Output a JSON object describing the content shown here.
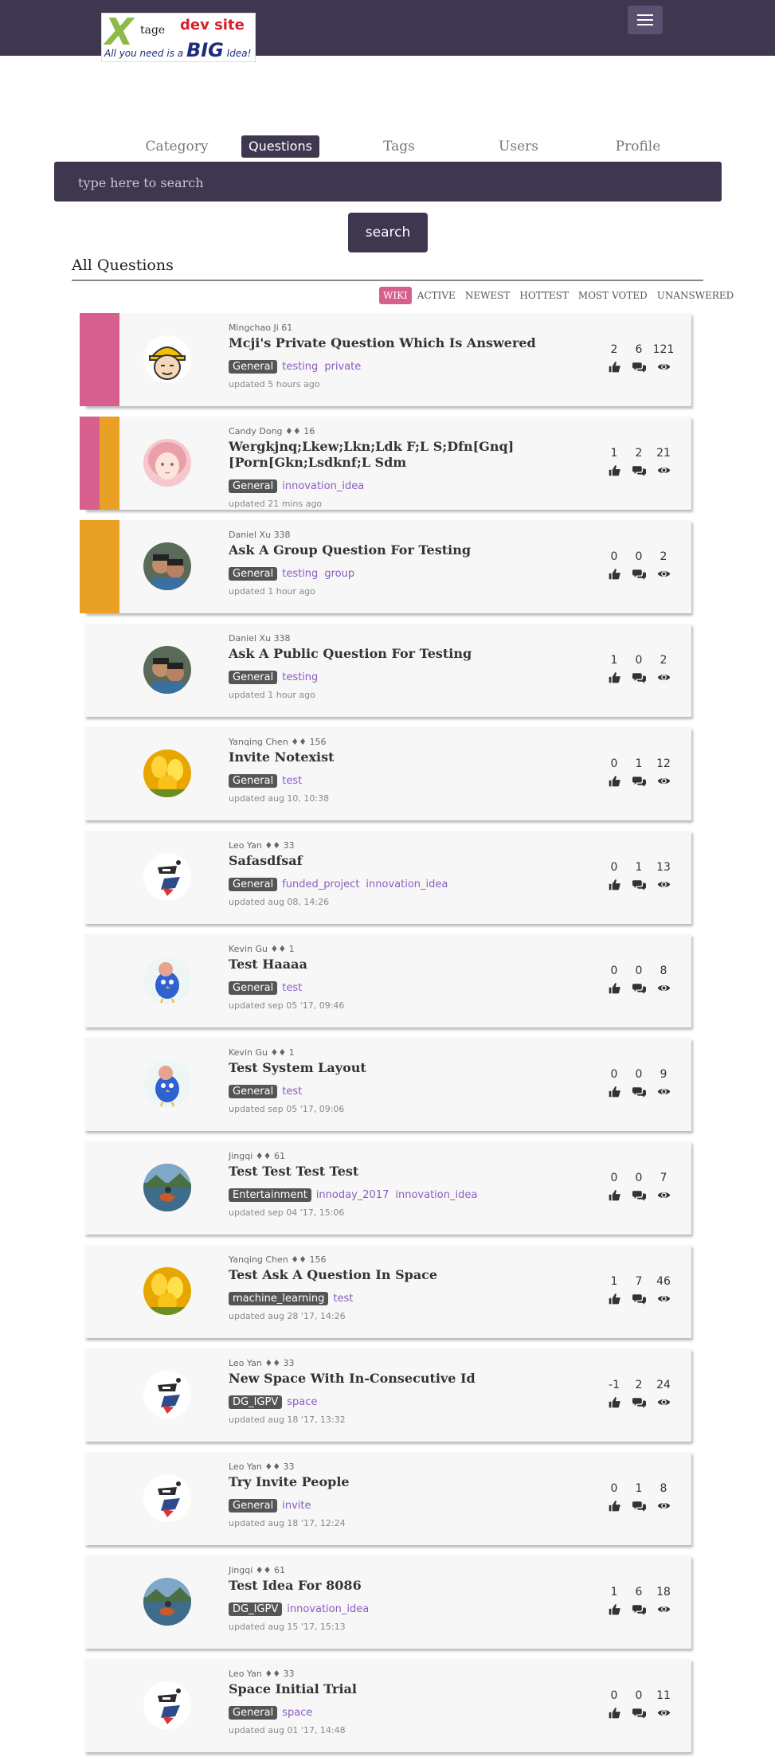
{
  "header": {
    "logo": {
      "letter": "X",
      "tage": "tage",
      "dev": "dev site",
      "slogan_pre": "All you need is a",
      "slogan_big": "BIG",
      "slogan_post": "Idea!"
    },
    "menu_icon": "hamburger-icon"
  },
  "nav": {
    "tabs": [
      "Category",
      "Questions",
      "Tags",
      "Users",
      "Profile"
    ],
    "active": "Questions"
  },
  "search": {
    "placeholder": "type here to search",
    "button": "search"
  },
  "section": {
    "title": "All Questions"
  },
  "filters": [
    "WIKI",
    "ACTIVE",
    "NEWEST",
    "HOTTEST",
    "MOST VOTED",
    "UNANSWERED"
  ],
  "colors": {
    "topbar": "#3f3650",
    "pink_flag": "#d65f8e",
    "orange_flag": "#e8a125",
    "tag": "#8c5cc0",
    "category": "#555555"
  },
  "questions": [
    {
      "author": "Mingchao Ji",
      "rep": "61",
      "title": "Mcji's Private Question Which Is Answered",
      "category": "General",
      "tags": [
        "testing",
        "private"
      ],
      "updated": "updated 5 hours ago",
      "votes": "2",
      "answers": "6",
      "views": "121",
      "avatar": "helmet-avatar",
      "flags": [
        "pink"
      ]
    },
    {
      "author": "Candy Dong",
      "rep": "♦♦ 16",
      "title": "Wergkjnq;Lkew;Lkn;Ldk F;L S;Dfn[Gnq][Porn[Gkn;Lsdknf;L Sdm",
      "category": "General",
      "tags": [
        "innovation_idea"
      ],
      "updated": "updated 21 mins ago",
      "votes": "1",
      "answers": "2",
      "views": "21",
      "avatar": "girl-avatar",
      "flags": [
        "pink",
        "orange"
      ]
    },
    {
      "author": "Daniel Xu",
      "rep": "338",
      "title": "Ask A Group Question For Testing",
      "category": "General",
      "tags": [
        "testing",
        "group"
      ],
      "updated": "updated 1 hour ago",
      "votes": "0",
      "answers": "0",
      "views": "2",
      "avatar": "kids-avatar",
      "flags": [
        "orange"
      ]
    },
    {
      "author": "Daniel Xu",
      "rep": "338",
      "title": "Ask A Public Question For Testing",
      "category": "General",
      "tags": [
        "testing"
      ],
      "updated": "updated 1 hour ago",
      "votes": "1",
      "answers": "0",
      "views": "2",
      "avatar": "kids-avatar",
      "flags": []
    },
    {
      "author": "Yanqing Chen",
      "rep": "♦♦ 156",
      "title": "Invite Notexist",
      "category": "General",
      "tags": [
        "test"
      ],
      "updated": "updated aug 10, 10:38",
      "votes": "0",
      "answers": "1",
      "views": "12",
      "avatar": "tulip-avatar",
      "flags": []
    },
    {
      "author": "Leo Yan",
      "rep": "♦♦ 33",
      "title": "Safasdfsaf",
      "category": "General",
      "tags": [
        "funded_project",
        "innovation_idea"
      ],
      "updated": "updated aug 08, 14:26",
      "votes": "0",
      "answers": "1",
      "views": "13",
      "avatar": "ninja-avatar",
      "flags": []
    },
    {
      "author": "Kevin Gu",
      "rep": "♦♦ 1",
      "title": "Test Haaaa",
      "category": "General",
      "tags": [
        "test"
      ],
      "updated": "updated sep 05 '17, 09:46",
      "votes": "0",
      "answers": "0",
      "views": "8",
      "avatar": "bird-avatar",
      "flags": []
    },
    {
      "author": "Kevin Gu",
      "rep": "♦♦ 1",
      "title": "Test System Layout",
      "category": "General",
      "tags": [
        "test"
      ],
      "updated": "updated sep 05 '17, 09:06",
      "votes": "0",
      "answers": "0",
      "views": "9",
      "avatar": "bird-avatar",
      "flags": []
    },
    {
      "author": "Jingqi",
      "rep": "♦♦ 61",
      "title": "Test Test Test Test",
      "category": "Entertainment",
      "tags": [
        "innoday_2017",
        "innovation_idea"
      ],
      "updated": "updated sep 04 '17, 15:06",
      "votes": "0",
      "answers": "0",
      "views": "7",
      "avatar": "lake-avatar",
      "flags": []
    },
    {
      "author": "Yanqing Chen",
      "rep": "♦♦ 156",
      "title": "Test Ask A Question In Space",
      "category": "machine_learning",
      "tags": [
        "test"
      ],
      "updated": "updated aug 28 '17, 14:26",
      "votes": "1",
      "answers": "7",
      "views": "46",
      "avatar": "tulip-avatar",
      "flags": []
    },
    {
      "author": "Leo Yan",
      "rep": "♦♦ 33",
      "title": "New Space With In-Consecutive Id",
      "category": "DG_IGPV",
      "tags": [
        "space"
      ],
      "updated": "updated aug 18 '17, 13:32",
      "votes": "-1",
      "answers": "2",
      "views": "24",
      "avatar": "ninja-avatar",
      "flags": []
    },
    {
      "author": "Leo Yan",
      "rep": "♦♦ 33",
      "title": "Try Invite People",
      "category": "General",
      "tags": [
        "invite"
      ],
      "updated": "updated aug 18 '17, 12:24",
      "votes": "0",
      "answers": "1",
      "views": "8",
      "avatar": "ninja-avatar",
      "flags": []
    },
    {
      "author": "Jingqi",
      "rep": "♦♦ 61",
      "title": "Test Idea For 8086",
      "category": "DG_IGPV",
      "tags": [
        "innovation_idea"
      ],
      "updated": "updated aug 15 '17, 15:13",
      "votes": "1",
      "answers": "6",
      "views": "18",
      "avatar": "lake-avatar",
      "flags": []
    },
    {
      "author": "Leo Yan",
      "rep": "♦♦ 33",
      "title": "Space Initial Trial",
      "category": "General",
      "tags": [
        "space"
      ],
      "updated": "updated aug 01 '17, 14:48",
      "votes": "0",
      "answers": "0",
      "views": "11",
      "avatar": "ninja-avatar",
      "flags": []
    }
  ]
}
